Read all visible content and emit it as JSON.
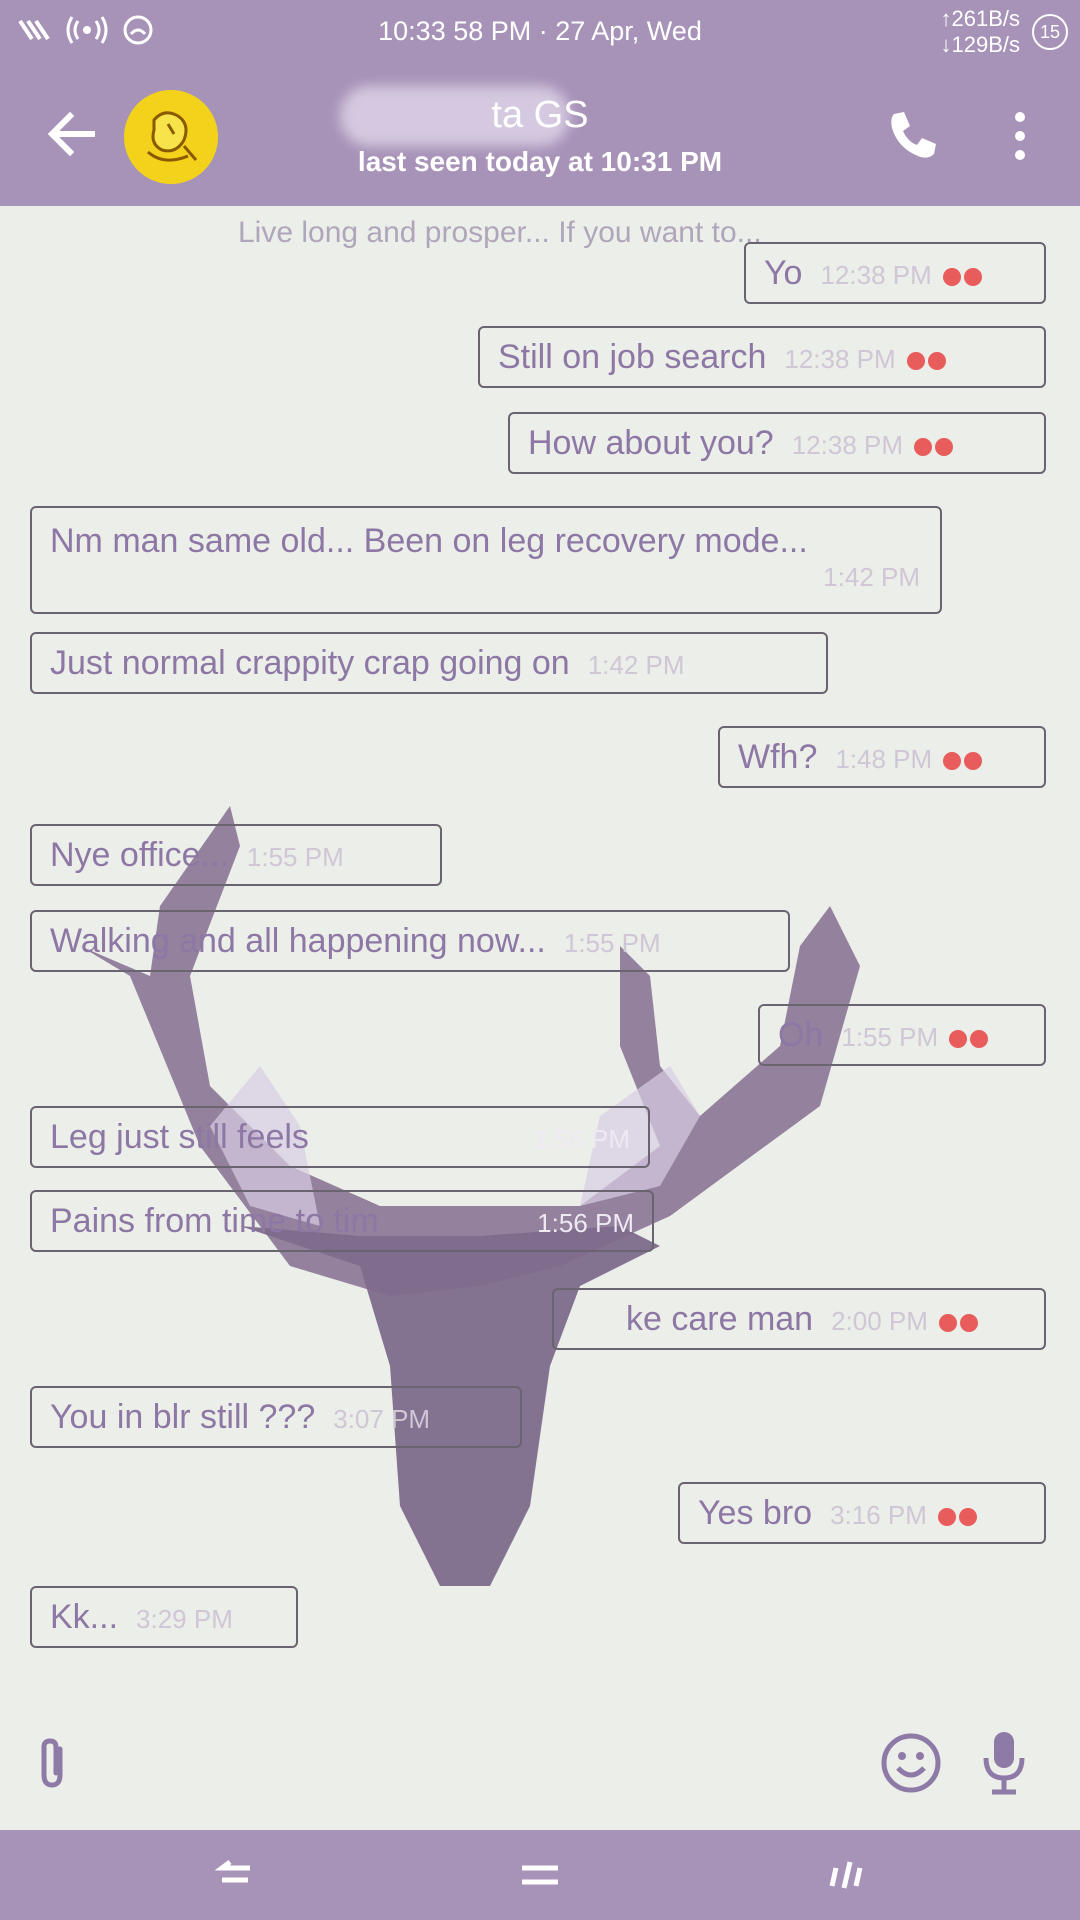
{
  "status_bar": {
    "datetime": "10:33 58 PM · 27 Apr, Wed",
    "upload_speed": "↑261B/s",
    "download_speed": "↓129B/s",
    "battery": "15"
  },
  "header": {
    "contact_name": "ta GS",
    "last_seen": "last seen today at 10:31 PM"
  },
  "chat": {
    "partial_message": "Live long and prosper... If you want to...",
    "messages": [
      {
        "text": "Yo",
        "time": "12:38 PM",
        "outgoing": true
      },
      {
        "text": "Still on job search",
        "time": "12:38 PM",
        "outgoing": true
      },
      {
        "text": "How about you?",
        "time": "12:38 PM",
        "outgoing": true
      },
      {
        "text": "Nm man same old... Been on leg recovery mode...",
        "time": "1:42 PM",
        "outgoing": false
      },
      {
        "text": "Just normal crappity crap going on",
        "time": "1:42 PM",
        "outgoing": false
      },
      {
        "text": "Wfh?",
        "time": "1:48 PM",
        "outgoing": true
      },
      {
        "text": "Nye office...",
        "time": "1:55 PM",
        "outgoing": false
      },
      {
        "text": "Walking and all happening now...",
        "time": "1:55 PM",
        "outgoing": false
      },
      {
        "text": "Oh",
        "time": "1:55 PM",
        "outgoing": true
      },
      {
        "text": "Leg just still feels",
        "time": "1:56 PM",
        "outgoing": false
      },
      {
        "text": "Pains from time to tim",
        "time": "1:56 PM",
        "outgoing": false
      },
      {
        "text": "ke care man",
        "time": "2:00 PM",
        "outgoing": true
      },
      {
        "text": "You in blr still ???",
        "time": "3:07 PM",
        "outgoing": false
      },
      {
        "text": "Yes bro",
        "time": "3:16 PM",
        "outgoing": true
      },
      {
        "text": "Kk...",
        "time": "3:29 PM",
        "outgoing": false
      }
    ]
  },
  "icons": {
    "back": "arrow-left-icon",
    "call": "phone-icon",
    "menu": "more-vert-icon",
    "attach": "paperclip-icon",
    "emoji": "smiley-icon",
    "mic": "microphone-icon"
  },
  "colors": {
    "accent": "#a893b8",
    "read_tick": "#e85c5c",
    "deer_wallpaper": "#8a7496"
  }
}
